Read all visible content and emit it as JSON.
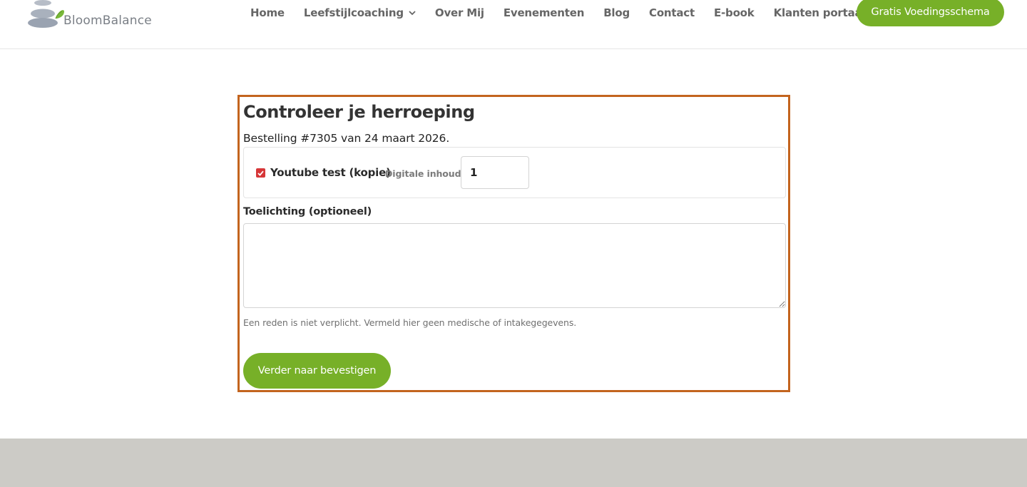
{
  "brand": {
    "name": "BloomBalance",
    "accent": "#77b028"
  },
  "nav": {
    "items": [
      {
        "label": "Home"
      },
      {
        "label": "Leefstijlcoaching",
        "has_dropdown": true
      },
      {
        "label": "Over Mij"
      },
      {
        "label": "Evenementen"
      },
      {
        "label": "Blog"
      },
      {
        "label": "Contact"
      },
      {
        "label": "E-book"
      },
      {
        "label": "Klanten portaal"
      }
    ],
    "cta_label": "Gratis Voedingsschema"
  },
  "form": {
    "title": "Controleer je herroeping",
    "order_line": "Bestelling #7305 van 24 maart 2026.",
    "item": {
      "name": "Youtube test (kopie)",
      "type": "Digitale inhoud",
      "checked": true,
      "quantity": "1"
    },
    "comment_label": "Toelichting (optioneel)",
    "comment_value": "",
    "hint": "Een reden is niet verplicht. Vermeld hier geen medische of intakegegevens.",
    "submit_label": "Verder naar bevestigen",
    "highlight_color": "#c3641e"
  }
}
